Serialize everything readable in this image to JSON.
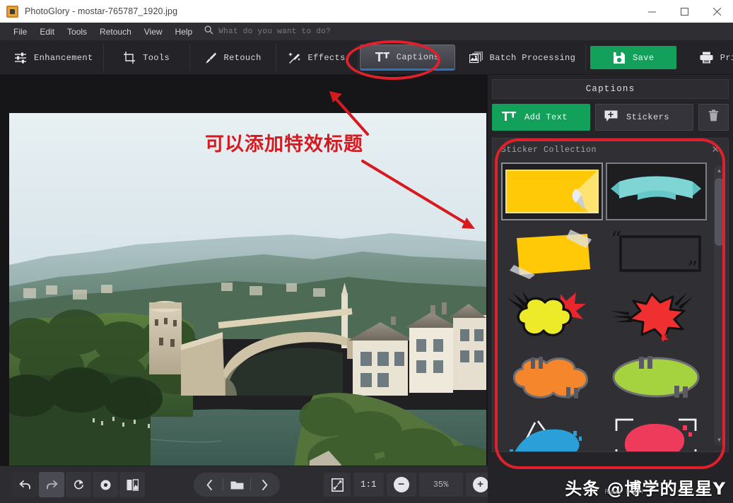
{
  "window": {
    "title": "PhotoGlory - mostar-765787_1920.jpg",
    "app_icon": "photoglory-icon",
    "minimize": "minimize-icon",
    "maximize": "maximize-icon",
    "close": "close-icon"
  },
  "menubar": {
    "items": [
      {
        "label": "File"
      },
      {
        "label": "Edit"
      },
      {
        "label": "Tools"
      },
      {
        "label": "Retouch"
      },
      {
        "label": "View"
      },
      {
        "label": "Help"
      }
    ],
    "search_placeholder": "What do you want to do?"
  },
  "toolbar": {
    "items": [
      {
        "label": "Enhancement",
        "icon": "sliders-icon",
        "active": false
      },
      {
        "label": "Tools",
        "icon": "crop-icon",
        "active": false
      },
      {
        "label": "Retouch",
        "icon": "brush-icon",
        "active": false
      },
      {
        "label": "Effects",
        "icon": "magic-wand-icon",
        "active": false
      },
      {
        "label": "Captions",
        "icon": "text-tool-icon",
        "active": true
      },
      {
        "label": "Batch Processing",
        "icon": "photos-stack-icon",
        "active": false
      },
      {
        "label": "Save",
        "icon": "floppy-disk-icon",
        "active": false
      },
      {
        "label": "Print",
        "icon": "printer-icon",
        "active": false
      }
    ]
  },
  "right_panel": {
    "title": "Captions",
    "add_text_label": "Add Text",
    "add_text_icon": "text-tool-icon",
    "stickers_label": "Stickers",
    "stickers_icon": "add-sticker-icon",
    "delete_icon": "trash-icon",
    "sticker_collection": {
      "title": "Sticker Collection",
      "close_icon": "close-icon",
      "scrollbar": {
        "up_icon": "scroll-up-arrow-icon",
        "down_icon": "scroll-down-arrow-icon"
      },
      "items": [
        {
          "name": "yellow-peeling-sticker",
          "selected": true
        },
        {
          "name": "teal-ribbon-banner",
          "selected": false
        },
        {
          "name": "yellow-taped-note",
          "selected": false
        },
        {
          "name": "quote-frame-box",
          "selected": false
        },
        {
          "name": "yellow-cloud-burst-bubble",
          "selected": false
        },
        {
          "name": "red-starburst-bubble",
          "selected": false
        },
        {
          "name": "orange-cloud-bubble",
          "selected": false
        },
        {
          "name": "green-ellipse-bubble",
          "selected": false
        },
        {
          "name": "blue-paint-stroke",
          "selected": false
        },
        {
          "name": "pink-paint-stroke-frame",
          "selected": false
        }
      ]
    }
  },
  "bottom_bar": {
    "undo_icon": "undo-icon",
    "redo_icon": "redo-icon",
    "rotate_icon": "rotate-icon",
    "preview_icon": "eye-icon",
    "compare_icon": "before-after-icon",
    "prev_icon": "chevron-left-icon",
    "open_folder_icon": "folder-icon",
    "next_icon": "chevron-right-icon",
    "fit_icon": "fit-to-screen-icon",
    "actual_size_label": "1:1",
    "zoom_out_icon": "zoom-out-icon",
    "zoom_level": "35%",
    "zoom_in_icon": "zoom-in-icon"
  },
  "annotations": {
    "caption_text": "可以添加特效标题",
    "arrow_to_captions": "red-arrow-up-left",
    "arrow_to_panel": "red-arrow-down-right",
    "highlight_captions": "red-ellipse-highlight",
    "highlight_stickers": "red-rounded-highlight",
    "accent_color": "#d71920"
  },
  "watermark": {
    "text": "头条 @博学的星星Y",
    "subtext": "Reri l ali"
  },
  "photo": {
    "name": "mostar-old-bridge-photo",
    "alt": "Mostar Old Bridge over Neretva river with stone town and green hills"
  }
}
